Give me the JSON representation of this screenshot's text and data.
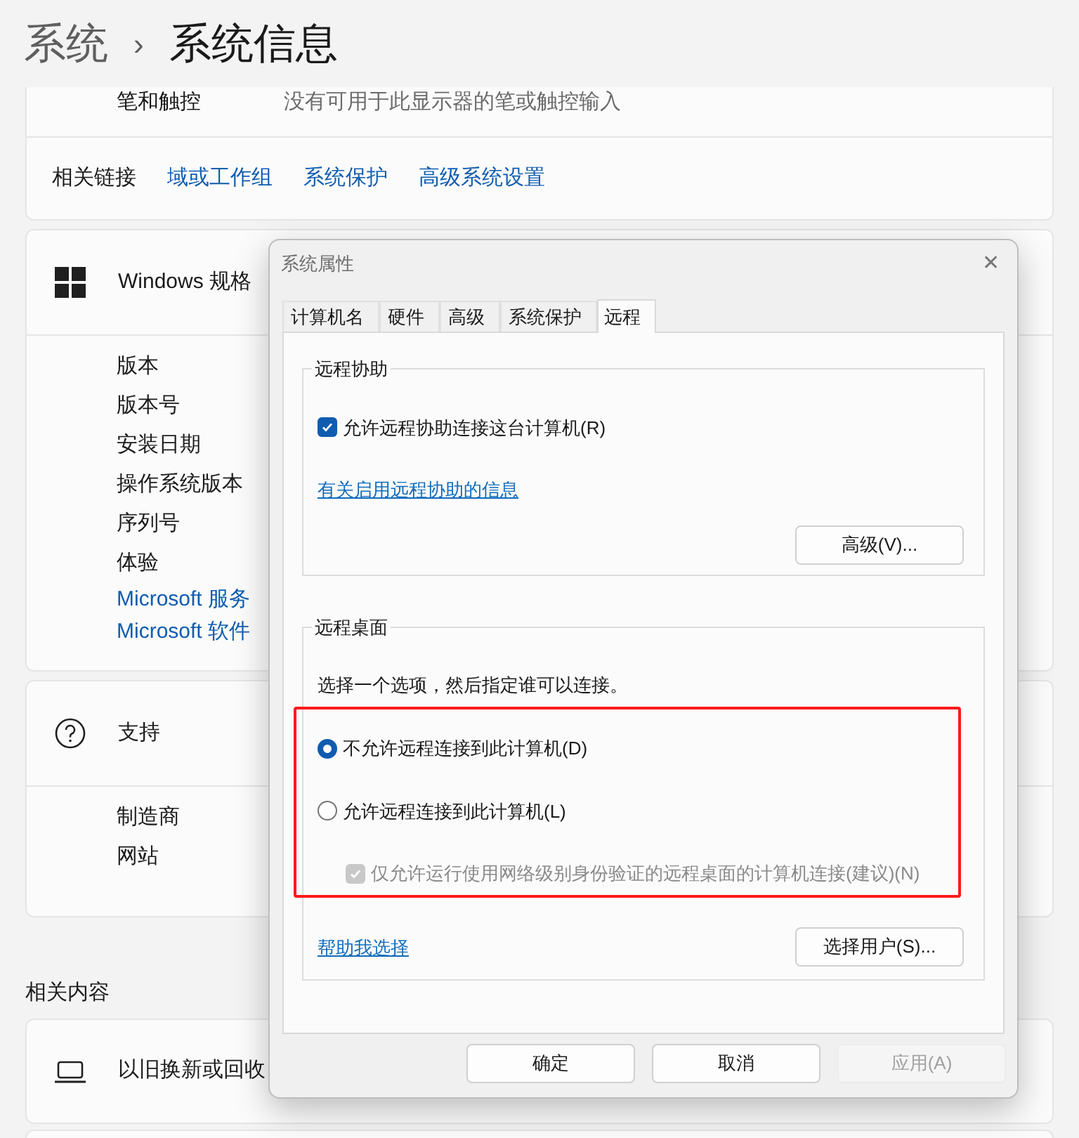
{
  "breadcrumb": {
    "parent": "系统",
    "separator": "›",
    "current": "系统信息"
  },
  "pen_card": {
    "rows": [
      {
        "label": "笔和触控",
        "value": "没有可用于此显示器的笔或触控输入"
      }
    ],
    "related_links": {
      "label": "相关链接",
      "links": [
        "域或工作组",
        "系统保护",
        "高级系统设置"
      ]
    }
  },
  "sections": [
    {
      "title": "Windows 规格",
      "items": [
        "版本",
        "版本号",
        "安装日期",
        "操作系统版本",
        "序列号",
        "体验"
      ],
      "links": [
        "Microsoft 服务",
        "Microsoft 软件"
      ]
    },
    {
      "title": "支持",
      "items": [
        "制造商",
        "网站"
      ]
    }
  ],
  "related_content": {
    "heading": "相关内容",
    "items": [
      {
        "label": "以旧换新或回收"
      }
    ]
  },
  "dialog": {
    "title": "系统属性",
    "close": "✕",
    "tabs": [
      {
        "label": "计算机名",
        "selected": false
      },
      {
        "label": "硬件",
        "selected": false
      },
      {
        "label": "高级",
        "selected": false
      },
      {
        "label": "系统保护",
        "selected": false
      },
      {
        "label": "远程",
        "selected": true
      }
    ],
    "remote_assistance": {
      "legend": "远程协助",
      "allow": {
        "label": "允许远程协助连接这台计算机(R)",
        "checked": true
      },
      "link": "有关启用远程协助的信息",
      "button": "高级(V)..."
    },
    "remote_desktop": {
      "legend": "远程桌面",
      "instruction": "选择一个选项，然后指定谁可以连接。",
      "options": [
        {
          "label": "不允许远程连接到此计算机(D)",
          "selected": true
        },
        {
          "label": "允许远程连接到此计算机(L)",
          "selected": false
        }
      ],
      "nla": {
        "label": "仅允许运行使用网络级别身份验证的远程桌面的计算机连接(建议)(N)",
        "checked": true,
        "disabled": true
      },
      "help_link": "帮助我选择",
      "button": "选择用户(S)..."
    },
    "buttons": [
      {
        "label": "确定",
        "disabled": false
      },
      {
        "label": "取消",
        "disabled": false
      },
      {
        "label": "应用(A)",
        "disabled": true
      }
    ]
  }
}
